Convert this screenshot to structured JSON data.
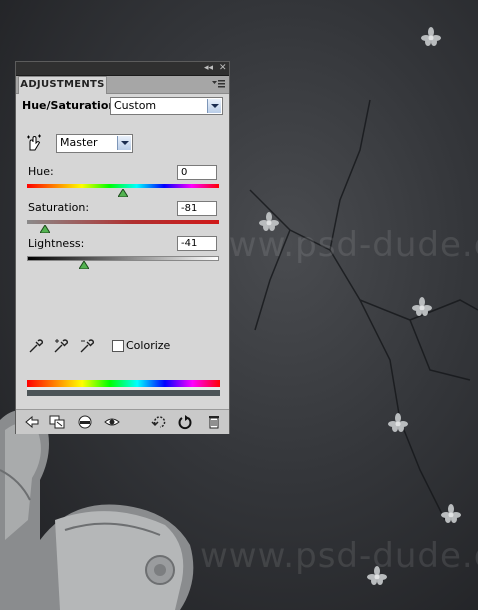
{
  "panel": {
    "tab_label": "ADJUSTMENTS",
    "title": "Hue/Saturation",
    "preset": "Custom",
    "channel": "Master",
    "hue": {
      "label": "Hue:",
      "value": "0",
      "fraction": 0.5
    },
    "saturation": {
      "label": "Saturation:",
      "value": "-81",
      "fraction": 0.095
    },
    "lightness": {
      "label": "Lightness:",
      "value": "-41",
      "fraction": 0.295
    },
    "colorize_label": "Colorize",
    "colorize_checked": false,
    "collapse_glyph": "◂◂",
    "close_glyph": "✕"
  },
  "background": {
    "watermark": "www.psd-dude.com"
  }
}
